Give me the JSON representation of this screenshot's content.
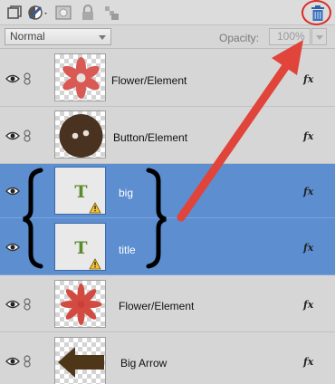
{
  "toolbar": {
    "icons": [
      "new-layer-icon",
      "adjustment-layer-icon",
      "mask-icon",
      "lock-icon",
      "lock-transparency-icon",
      "trash-icon"
    ]
  },
  "blend": {
    "mode": "Normal",
    "opacity_label": "Opacity:",
    "opacity_value": "100%"
  },
  "layers": [
    {
      "name": "Flower/Element",
      "type": "image",
      "icon": "flower-thumbnail",
      "selected": false,
      "fx": "fx"
    },
    {
      "name": "Button/Element",
      "type": "image",
      "icon": "button-thumbnail",
      "selected": false,
      "fx": "fx"
    },
    {
      "name": "big",
      "type": "text",
      "icon": "text-layer-thumbnail",
      "selected": true,
      "fx": "fx"
    },
    {
      "name": "title",
      "type": "text",
      "icon": "text-layer-thumbnail",
      "selected": true,
      "fx": "fx"
    },
    {
      "name": "Flower/Element",
      "type": "image",
      "icon": "flower-thumbnail",
      "selected": false,
      "fx": "fx"
    },
    {
      "name": "Big Arrow",
      "type": "image",
      "icon": "arrow-thumbnail",
      "selected": false,
      "fx": "fx"
    }
  ],
  "text_thumb_glyph": "T",
  "annotation": {
    "color": "#e0443a",
    "circle_color": "#d92b25"
  },
  "colors": {
    "selected_row": "#5c8ed0",
    "panel": "#d6d6d6",
    "flower": "#d95a55",
    "button": "#4a3220",
    "arrow": "#4e3618",
    "text_glyph": "#5a8a2a"
  }
}
